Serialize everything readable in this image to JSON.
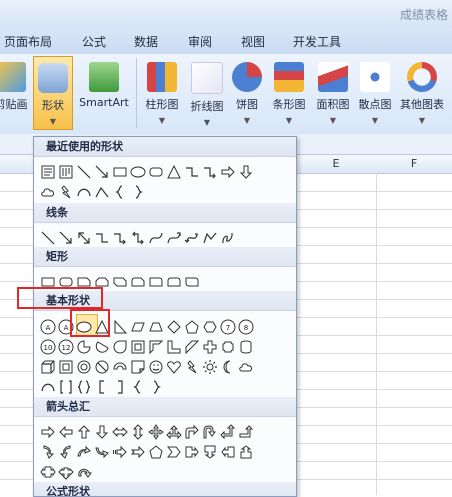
{
  "window": {
    "title": "成绩表格"
  },
  "tabs": [
    "页面布局",
    "公式",
    "数据",
    "审阅",
    "视图",
    "开发工具"
  ],
  "ribbon": {
    "left_partial": "剪贴画",
    "shapes_button": "形状",
    "smartart_button": "SmartArt",
    "charts": [
      "柱形图",
      "折线图",
      "饼图",
      "条形图",
      "面积图",
      "散点图",
      "其他图表"
    ]
  },
  "columns": [
    "E",
    "F"
  ],
  "menu": {
    "sections": [
      "最近使用的形状",
      "线条",
      "矩形",
      "基本形状",
      "箭头总汇",
      "公式形状"
    ],
    "recent_shapes": [
      "text-box",
      "vertical-text",
      "line",
      "arrow",
      "rect",
      "oval",
      "rounded",
      "triangle",
      "elbow",
      "elbow-arrow",
      "block-right",
      "block-down"
    ],
    "recent_shapes_row2": [
      "cloud",
      "lightning",
      "arc",
      "arc-open",
      "brace-left",
      "brace-right"
    ],
    "lines": [
      "line",
      "arrow",
      "double-arrow",
      "elbow",
      "elbow-arrow",
      "elbow-double",
      "curve",
      "curve-arrow",
      "curve-double",
      "freeform",
      "scribble"
    ],
    "rectangles": [
      "rect",
      "rounded",
      "snip1",
      "snip2",
      "snip-diag",
      "snip-round",
      "round1",
      "round2",
      "round-diag"
    ],
    "basic_row1": [
      "text-box",
      "vertical-text",
      "oval",
      "triangle",
      "right-triangle",
      "parallelogram",
      "trapezoid",
      "diamond",
      "pentagon",
      "hexagon",
      "heptagon",
      "octagon"
    ],
    "basic_row1_labels": [
      "A",
      "A",
      "",
      "",
      "",
      "",
      "",
      "",
      "",
      "",
      "7",
      "8"
    ],
    "basic_row2_labels": [
      "10",
      "12"
    ],
    "basic_row2": [
      "decagon",
      "dodecagon",
      "pie",
      "chord",
      "tear",
      "frame",
      "half-frame",
      "l-shape",
      "diag-stripe",
      "cross",
      "plaque",
      "can"
    ],
    "basic_row3": [
      "cube",
      "bevel",
      "donut",
      "no",
      "block-arc",
      "fold",
      "smile",
      "heart",
      "lightning",
      "sun",
      "moon",
      "cloud"
    ],
    "basic_row4": [
      "arc",
      "brackets",
      "braces",
      "bracket-left",
      "bracket-right",
      "brace-left",
      "brace-right"
    ],
    "arrows_row1": [
      "right",
      "left",
      "up",
      "down",
      "left-right",
      "up-down",
      "quad",
      "lr-up",
      "bent",
      "u-turn",
      "left-up",
      "bent-up"
    ],
    "arrows_row2": [
      "curved-right",
      "curved-left",
      "curved-up",
      "curved-down",
      "striped",
      "notched",
      "pentagon",
      "chevron",
      "right-callout",
      "down-callout",
      "left-callout",
      "up-callout"
    ],
    "arrows_row3": [
      "lr-callout",
      "quad-callout",
      "circular"
    ]
  }
}
